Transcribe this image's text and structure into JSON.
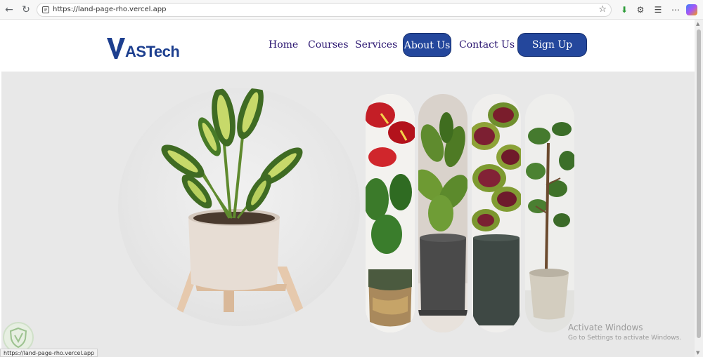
{
  "browser": {
    "url": "https://land-page-rho.vercel.app",
    "status_url": "https://land-page-rho.vercel.app"
  },
  "site": {
    "logo": {
      "mark": "V",
      "brand_a": "AS",
      "brand_b": "Tech"
    },
    "nav": [
      {
        "label": "Home",
        "active": false
      },
      {
        "label": "Courses",
        "active": false
      },
      {
        "label": "Services",
        "active": false
      },
      {
        "label": "About Us",
        "active": true
      },
      {
        "label": "Contact Us",
        "active": false
      }
    ],
    "signup_label": "Sign Up"
  },
  "hero": {
    "main_image": "potted-plant-circle",
    "pills": [
      "anthurium-plant",
      "fiddle-leaf-plant",
      "coleus-plant",
      "fig-tree-plant"
    ]
  },
  "watermark": {
    "title": "Activate Windows",
    "subtitle": "Go to Settings to activate Windows."
  },
  "colors": {
    "brand": "#24479c",
    "nav_text": "#2a1570",
    "page_bg": "#e8e8e8"
  }
}
